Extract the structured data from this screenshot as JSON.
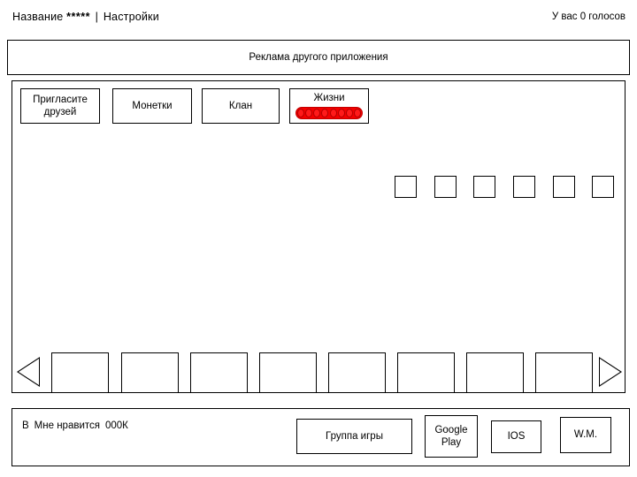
{
  "topbar": {
    "title_prefix": "Название",
    "title_stars": "*****",
    "separator": "|",
    "settings_label": "Настройки",
    "votes_label": "У вас 0 голосов"
  },
  "ad": {
    "text": "Реклама другого приложения"
  },
  "main": {
    "buttons": [
      {
        "id": "invite",
        "label": "Пригласите друзей"
      },
      {
        "id": "coins",
        "label": "Монетки"
      },
      {
        "id": "clan",
        "label": "Клан"
      }
    ],
    "lives": {
      "label": "Жизни",
      "pip_count": 8,
      "bar_color": "#f40000"
    },
    "slot_count": 6,
    "carousel": {
      "cell_count": 8,
      "prev_icon": "triangle-left-icon",
      "next_icon": "triangle-right-icon"
    }
  },
  "footer": {
    "like": {
      "mark": "B",
      "label": "Мне нравится",
      "count": "000К"
    },
    "buttons": [
      {
        "id": "group",
        "label": "Группа игры"
      },
      {
        "id": "gplay",
        "label": "Google Play"
      },
      {
        "id": "ios",
        "label": "IOS"
      },
      {
        "id": "wm",
        "label": "W.M."
      }
    ]
  }
}
